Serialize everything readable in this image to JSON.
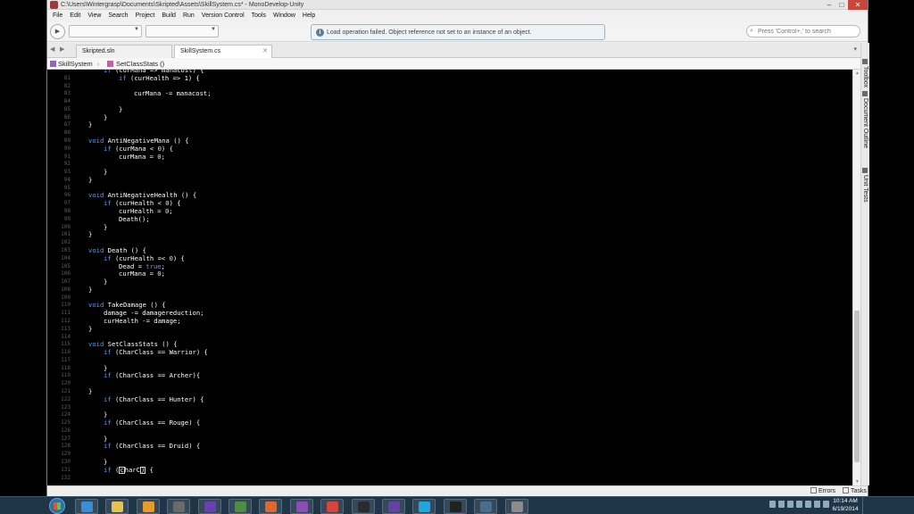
{
  "window": {
    "title": "C:\\Users\\Wintergrasp\\Documents\\Skripted\\Assets\\SkillSystem.cs* - MonoDevelop-Unity",
    "minimize": "–",
    "maximize": "□",
    "close": "✕"
  },
  "menu": [
    "File",
    "Edit",
    "View",
    "Search",
    "Project",
    "Build",
    "Run",
    "Version Control",
    "Tools",
    "Window",
    "Help"
  ],
  "toolbar": {
    "run_icon": "play-icon",
    "status_message": "Load operation failed. Object reference not set to an instance of an object.",
    "search_placeholder": "Press 'Control+,' to search"
  },
  "tabs": [
    {
      "label": "Skripted.sln",
      "active": false
    },
    {
      "label": "SkillSystem.cs",
      "active": true
    }
  ],
  "breadcrumb": {
    "class_name": "SkillSystem",
    "method_name": "SetClassStats ()"
  },
  "side_panels": [
    "Toolbox",
    "Document Outline",
    "Unit Tests"
  ],
  "status_pads": [
    "Errors",
    "Tasks"
  ],
  "code_lines": [
    {
      "n": "",
      "indent": 1,
      "parts": [
        [
          "kw",
          "if"
        ],
        [
          "t",
          " (curMana => manacost) {"
        ]
      ]
    },
    {
      "n": "81",
      "indent": 2,
      "parts": [
        [
          "kw",
          "if"
        ],
        [
          "t",
          " (curHealth => 1) {"
        ]
      ]
    },
    {
      "n": "82",
      "indent": 0,
      "parts": []
    },
    {
      "n": "83",
      "indent": 3,
      "parts": [
        [
          "t",
          "curMana -= manacost;"
        ]
      ]
    },
    {
      "n": "84",
      "indent": 0,
      "parts": []
    },
    {
      "n": "85",
      "indent": 2,
      "parts": [
        [
          "t",
          "}"
        ]
      ]
    },
    {
      "n": "86",
      "indent": 1,
      "parts": [
        [
          "t",
          "}"
        ]
      ]
    },
    {
      "n": "87",
      "indent": 0,
      "parts": [
        [
          "t",
          "}"
        ]
      ]
    },
    {
      "n": "88",
      "indent": 0,
      "parts": []
    },
    {
      "n": "89",
      "indent": 0,
      "parts": [
        [
          "kw",
          "void"
        ],
        [
          "t",
          " AntiNegativeMana () {"
        ]
      ]
    },
    {
      "n": "90",
      "indent": 1,
      "parts": [
        [
          "kw",
          "if"
        ],
        [
          "t",
          " (curMana < "
        ],
        [
          "num",
          "0"
        ],
        [
          "t",
          ") {"
        ]
      ]
    },
    {
      "n": "91",
      "indent": 2,
      "parts": [
        [
          "t",
          "curMana = "
        ],
        [
          "num",
          "0"
        ],
        [
          "t",
          ";"
        ]
      ]
    },
    {
      "n": "92",
      "indent": 0,
      "parts": []
    },
    {
      "n": "93",
      "indent": 1,
      "parts": [
        [
          "t",
          "}"
        ]
      ]
    },
    {
      "n": "94",
      "indent": 0,
      "parts": [
        [
          "t",
          "}"
        ]
      ]
    },
    {
      "n": "95",
      "indent": 0,
      "parts": []
    },
    {
      "n": "96",
      "indent": 0,
      "parts": [
        [
          "kw",
          "void"
        ],
        [
          "t",
          " AntiNegativeHealth () {"
        ]
      ]
    },
    {
      "n": "97",
      "indent": 1,
      "parts": [
        [
          "kw",
          "if"
        ],
        [
          "t",
          " (curHealth < "
        ],
        [
          "num",
          "0"
        ],
        [
          "t",
          ") {"
        ]
      ]
    },
    {
      "n": "98",
      "indent": 2,
      "parts": [
        [
          "t",
          "curHealth = "
        ],
        [
          "num",
          "0"
        ],
        [
          "t",
          ";"
        ]
      ]
    },
    {
      "n": "99",
      "indent": 2,
      "parts": [
        [
          "t",
          "Death();"
        ]
      ]
    },
    {
      "n": "100",
      "indent": 1,
      "parts": [
        [
          "t",
          "}"
        ]
      ]
    },
    {
      "n": "101",
      "indent": 0,
      "parts": [
        [
          "t",
          "}"
        ]
      ]
    },
    {
      "n": "102",
      "indent": 0,
      "parts": []
    },
    {
      "n": "103",
      "indent": 0,
      "parts": [
        [
          "kw",
          "void"
        ],
        [
          "t",
          " Death () {"
        ]
      ]
    },
    {
      "n": "104",
      "indent": 1,
      "parts": [
        [
          "kw",
          "if"
        ],
        [
          "t",
          " (curHealth =< "
        ],
        [
          "num",
          "0"
        ],
        [
          "t",
          ") {"
        ]
      ]
    },
    {
      "n": "105",
      "indent": 2,
      "parts": [
        [
          "t",
          "Dead = "
        ],
        [
          "kw",
          "true"
        ],
        [
          "t",
          ";"
        ]
      ]
    },
    {
      "n": "106",
      "indent": 2,
      "parts": [
        [
          "t",
          "curMana = "
        ],
        [
          "num",
          "0"
        ],
        [
          "t",
          ";"
        ]
      ]
    },
    {
      "n": "107",
      "indent": 1,
      "parts": [
        [
          "t",
          "}"
        ]
      ]
    },
    {
      "n": "108",
      "indent": 0,
      "parts": [
        [
          "t",
          "}"
        ]
      ]
    },
    {
      "n": "109",
      "indent": 0,
      "parts": []
    },
    {
      "n": "110",
      "indent": 0,
      "parts": [
        [
          "kw",
          "void"
        ],
        [
          "t",
          " TakeDamage () {"
        ]
      ]
    },
    {
      "n": "111",
      "indent": 1,
      "parts": [
        [
          "t",
          "damage -= damagereduction;"
        ]
      ]
    },
    {
      "n": "112",
      "indent": 1,
      "parts": [
        [
          "t",
          "curHealth -= damage;"
        ]
      ]
    },
    {
      "n": "113",
      "indent": 0,
      "parts": [
        [
          "t",
          "}"
        ]
      ]
    },
    {
      "n": "114",
      "indent": 0,
      "parts": []
    },
    {
      "n": "115",
      "indent": 0,
      "parts": [
        [
          "kw",
          "void"
        ],
        [
          "t",
          " SetClassStats () {"
        ]
      ]
    },
    {
      "n": "116",
      "indent": 1,
      "parts": [
        [
          "kw",
          "if"
        ],
        [
          "t",
          " (CharClass == Warrior) {"
        ]
      ]
    },
    {
      "n": "117",
      "indent": 0,
      "parts": []
    },
    {
      "n": "118",
      "indent": 1,
      "parts": [
        [
          "t",
          "}"
        ]
      ]
    },
    {
      "n": "119",
      "indent": 1,
      "parts": [
        [
          "kw",
          "if"
        ],
        [
          "t",
          " (CharClass == Archer){"
        ]
      ]
    },
    {
      "n": "120",
      "indent": 0,
      "parts": []
    },
    {
      "n": "121",
      "indent": 0,
      "parts": [
        [
          "t",
          "}"
        ]
      ]
    },
    {
      "n": "122",
      "indent": 1,
      "parts": [
        [
          "kw",
          "if"
        ],
        [
          "t",
          " (CharClass == Hunter) {"
        ]
      ]
    },
    {
      "n": "123",
      "indent": 0,
      "parts": []
    },
    {
      "n": "124",
      "indent": 1,
      "parts": [
        [
          "t",
          "}"
        ]
      ]
    },
    {
      "n": "125",
      "indent": 1,
      "parts": [
        [
          "kw",
          "if"
        ],
        [
          "t",
          " (CharClass == Rouge) {"
        ]
      ]
    },
    {
      "n": "126",
      "indent": 0,
      "parts": []
    },
    {
      "n": "127",
      "indent": 1,
      "parts": [
        [
          "t",
          "}"
        ]
      ]
    },
    {
      "n": "128",
      "indent": 1,
      "parts": [
        [
          "kw",
          "if"
        ],
        [
          "t",
          " (CharClass == Druid) {"
        ]
      ]
    },
    {
      "n": "129",
      "indent": 0,
      "parts": []
    },
    {
      "n": "130",
      "indent": 1,
      "parts": [
        [
          "t",
          "}"
        ]
      ]
    },
    {
      "n": "131",
      "indent": 1,
      "parts": [
        [
          "kw",
          "if"
        ],
        [
          "t",
          " ("
        ],
        [
          "caret",
          "c"
        ],
        [
          "t",
          "harC"
        ],
        [
          "caret",
          ")"
        ],
        [
          "t",
          " {"
        ]
      ]
    },
    {
      "n": "132",
      "indent": 0,
      "parts": []
    }
  ],
  "colors": {
    "editor_bg": "#000000",
    "keyword": "#5b9be8",
    "text": "#ffffff",
    "line_number": "#5e5e5e",
    "close_button": "#c8463a"
  },
  "taskbar": {
    "start_icon": "windows-start-icon",
    "apps": [
      {
        "name": "ie-icon",
        "color": "#3a8ed8"
      },
      {
        "name": "folder-icon",
        "color": "#e8c24e"
      },
      {
        "name": "media-player-icon",
        "color": "#e89a2e"
      },
      {
        "name": "app-4-icon",
        "color": "#6a6a6a"
      },
      {
        "name": "visual-studio-icon",
        "color": "#6b3fb3"
      },
      {
        "name": "app-green-icon",
        "color": "#4e8e3e"
      },
      {
        "name": "firefox-icon",
        "color": "#e0682a"
      },
      {
        "name": "app-purple-icon",
        "color": "#8a4db5"
      },
      {
        "name": "chrome-icon",
        "color": "#d6463a"
      },
      {
        "name": "obs-icon",
        "color": "#2b2b2b"
      },
      {
        "name": "twitch-icon",
        "color": "#6441a4"
      },
      {
        "name": "skype-icon",
        "color": "#1fa7e0"
      },
      {
        "name": "unity-icon",
        "color": "#222222"
      },
      {
        "name": "app-shield-icon",
        "color": "#4a6d8c"
      },
      {
        "name": "monodevelop-icon",
        "color": "#8c8c8c"
      }
    ],
    "clock_time": "10:14 AM",
    "clock_date": "6/19/2014"
  }
}
